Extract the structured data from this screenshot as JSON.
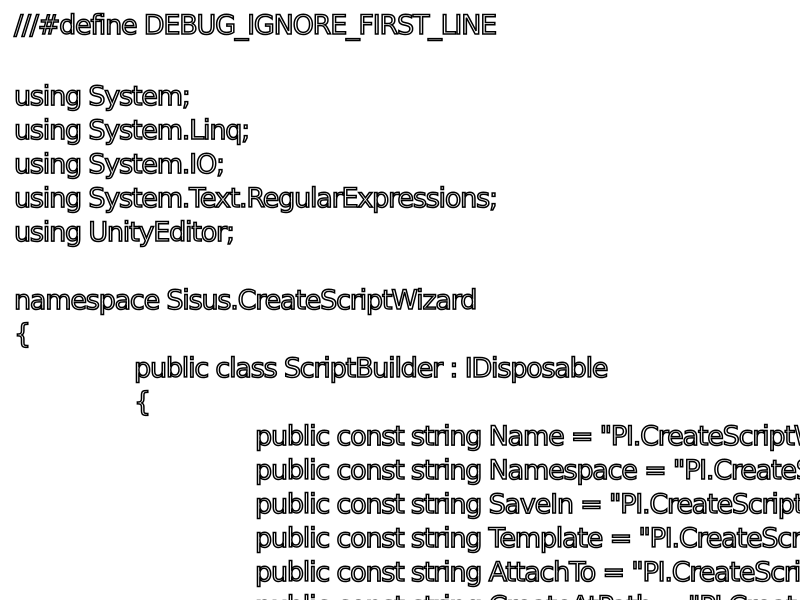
{
  "code": {
    "line1": "///#define DEBUG_IGNORE_FIRST_LINE",
    "line3": "using System;",
    "line4": "using System.Linq;",
    "line5": "using System.IO;",
    "line6": "using System.Text.RegularExpressions;",
    "line7": "using UnityEditor;",
    "line9": "namespace Sisus.CreateScriptWizard",
    "line10": "{",
    "line11": "public class ScriptBuilder : IDisposable",
    "line12": "{",
    "line13": "public const string Name = \"PI.CreateScriptWizard.Name\";",
    "line14": "public const string Namespace = \"PI.CreateScriptWizard.Namespace\";",
    "line15": "public const string SaveIn = \"PI.CreateScriptWizard.SaveIn\";",
    "line16": "public const string Template = \"PI.CreateScriptWizard.Template\";",
    "line17": "public const string AttachTo = \"PI.CreateScriptWizard.AttachTo\";",
    "line18": "public const string CreateAtPath = \"PI.CreateScriptWizard.CreateAtPath\";"
  }
}
